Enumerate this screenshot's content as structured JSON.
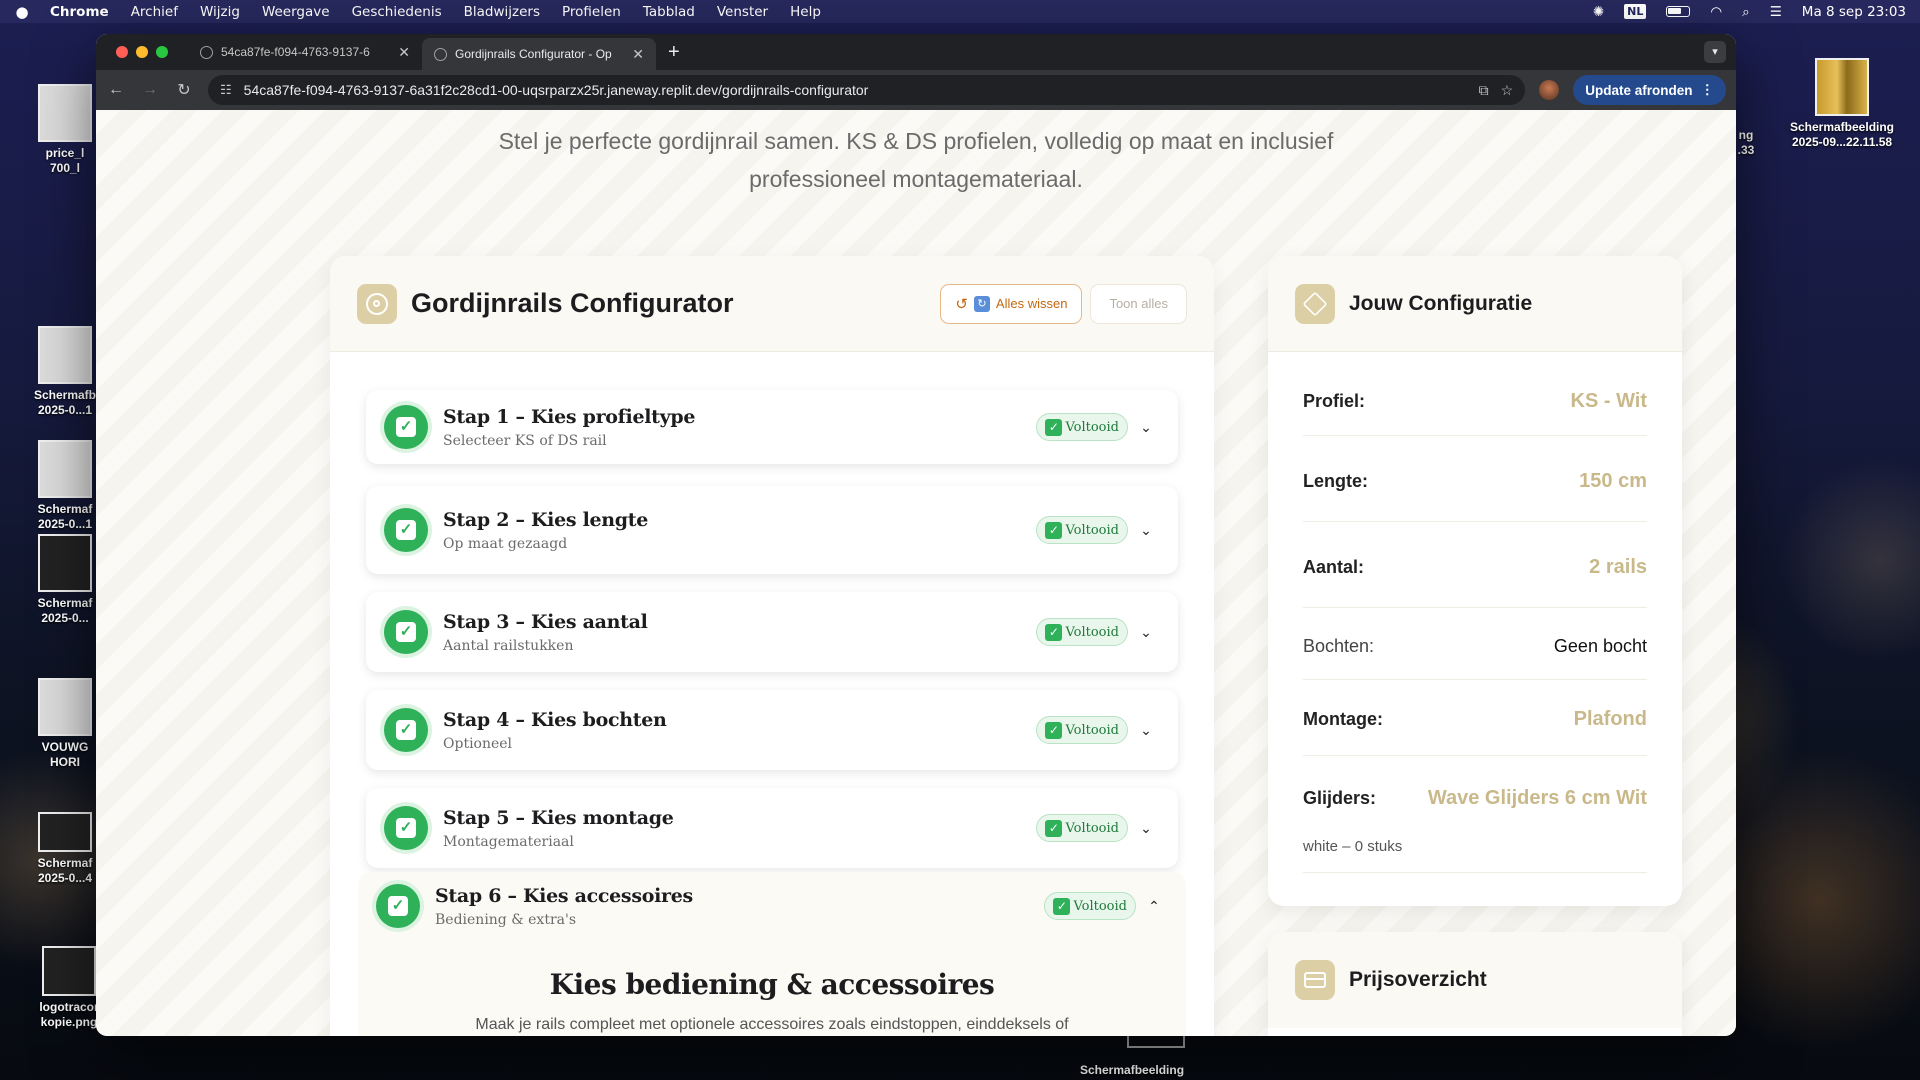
{
  "menubar": {
    "app": "Chrome",
    "items": [
      "Archief",
      "Wijzig",
      "Weergave",
      "Geschiedenis",
      "Bladwijzers",
      "Profielen",
      "Tabblad",
      "Venster",
      "Help"
    ],
    "lang": "NL",
    "clock": "Ma 8 sep  23:03"
  },
  "desktop": {
    "icons": [
      {
        "label": "price_l\n700_l"
      },
      {
        "label": "Schermafb\n2025-0...1"
      },
      {
        "label": "Schermaf\n2025-0...1"
      },
      {
        "label": "Schermaf\n2025-0..."
      },
      {
        "label": "VOUWG\nHORI"
      },
      {
        "label": "Schermaf\n2025-0...4"
      },
      {
        "label": "logotracor\nkopie.png"
      },
      {
        "label": "ng\n.33"
      },
      {
        "label": "Schermafbeelding\n2025-09...22.11.58"
      }
    ],
    "bottom_label": "Schermafbeelding"
  },
  "browser": {
    "tabs": [
      {
        "title": "54ca87fe-f094-4763-9137-6"
      },
      {
        "title": "Gordijnrails Configurator - Op"
      }
    ],
    "url": "54ca87fe-f094-4763-9137-6a31f2c28cd1-00-uqsrparzx25r.janeway.replit.dev/gordijnrails-configurator",
    "update_label": "Update afronden"
  },
  "page": {
    "intro": "Stel je perfecte gordijnrail samen. KS & DS profielen, volledig op maat en inclusief professioneel montagemateriaal."
  },
  "configurator": {
    "title": "Gordijnrails Configurator",
    "clear_label": "Alles wissen",
    "show_all_label": "Toon alles",
    "steps": [
      {
        "title": "Stap 1 – Kies profieltype",
        "subtitle": "Selecteer KS of DS rail",
        "status": "Voltooid"
      },
      {
        "title": "Stap 2 – Kies lengte",
        "subtitle": "Op maat gezaagd",
        "status": "Voltooid"
      },
      {
        "title": "Stap 3 – Kies aantal",
        "subtitle": "Aantal railstukken",
        "status": "Voltooid"
      },
      {
        "title": "Stap 4 – Kies bochten",
        "subtitle": "Optioneel",
        "status": "Voltooid"
      },
      {
        "title": "Stap 5 – Kies montage",
        "subtitle": "Montagemateriaal",
        "status": "Voltooid"
      },
      {
        "title": "Stap 6 – Kies accessoires",
        "subtitle": "Bediening & extra's",
        "status": "Voltooid"
      }
    ],
    "accessories": {
      "title": "Kies bediening & accessoires",
      "subtitle": "Maak je rails compleet met optionele accessoires zoals eindstoppen, einddeksels of"
    }
  },
  "summary": {
    "title": "Jouw Configuratie",
    "rows": [
      {
        "label": "Profiel:",
        "value": "KS - Wit"
      },
      {
        "label": "Lengte:",
        "value": "150 cm"
      },
      {
        "label": "Aantal:",
        "value": "2 rails"
      },
      {
        "label": "Bochten:",
        "value": "Geen bocht"
      },
      {
        "label": "Montage:",
        "value": "Plafond"
      },
      {
        "label": "Glijders:",
        "value": "Wave Glijders 6 cm Wit"
      }
    ],
    "glider_detail": "white – 0 stuks"
  },
  "price": {
    "title": "Prijsoverzicht"
  },
  "colors": {
    "accent_gold": "#c9b98a",
    "success_green": "#2fb15a",
    "clear_orange": "#c2680f"
  }
}
